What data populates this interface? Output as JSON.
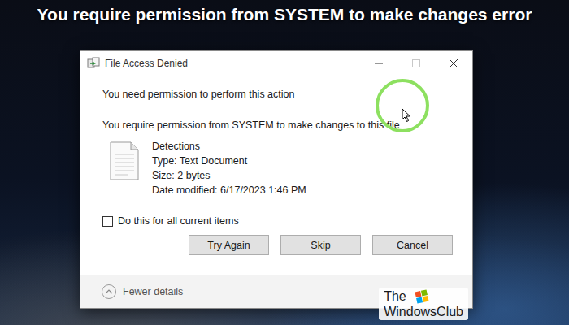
{
  "header": {
    "title": "You require permission from SYSTEM to make changes error"
  },
  "window": {
    "title": "File Access Denied",
    "maximize_enabled": false
  },
  "message": {
    "heading": "You need permission to perform this action",
    "detail": "You require permission from SYSTEM to make changes to this file"
  },
  "file": {
    "name": "Detections",
    "details": [
      "Type: Text Document",
      "Size: 2 bytes",
      "Date modified: 6/17/2023 1:46 PM"
    ]
  },
  "checkbox": {
    "label": "Do this for all current items",
    "checked": false
  },
  "buttons": [
    "Try Again",
    "Skip",
    "Cancel"
  ],
  "details_toggle": {
    "label": "Fewer details",
    "expanded": true
  },
  "watermark": {
    "lines": [
      "The",
      "WindowsClub"
    ]
  }
}
